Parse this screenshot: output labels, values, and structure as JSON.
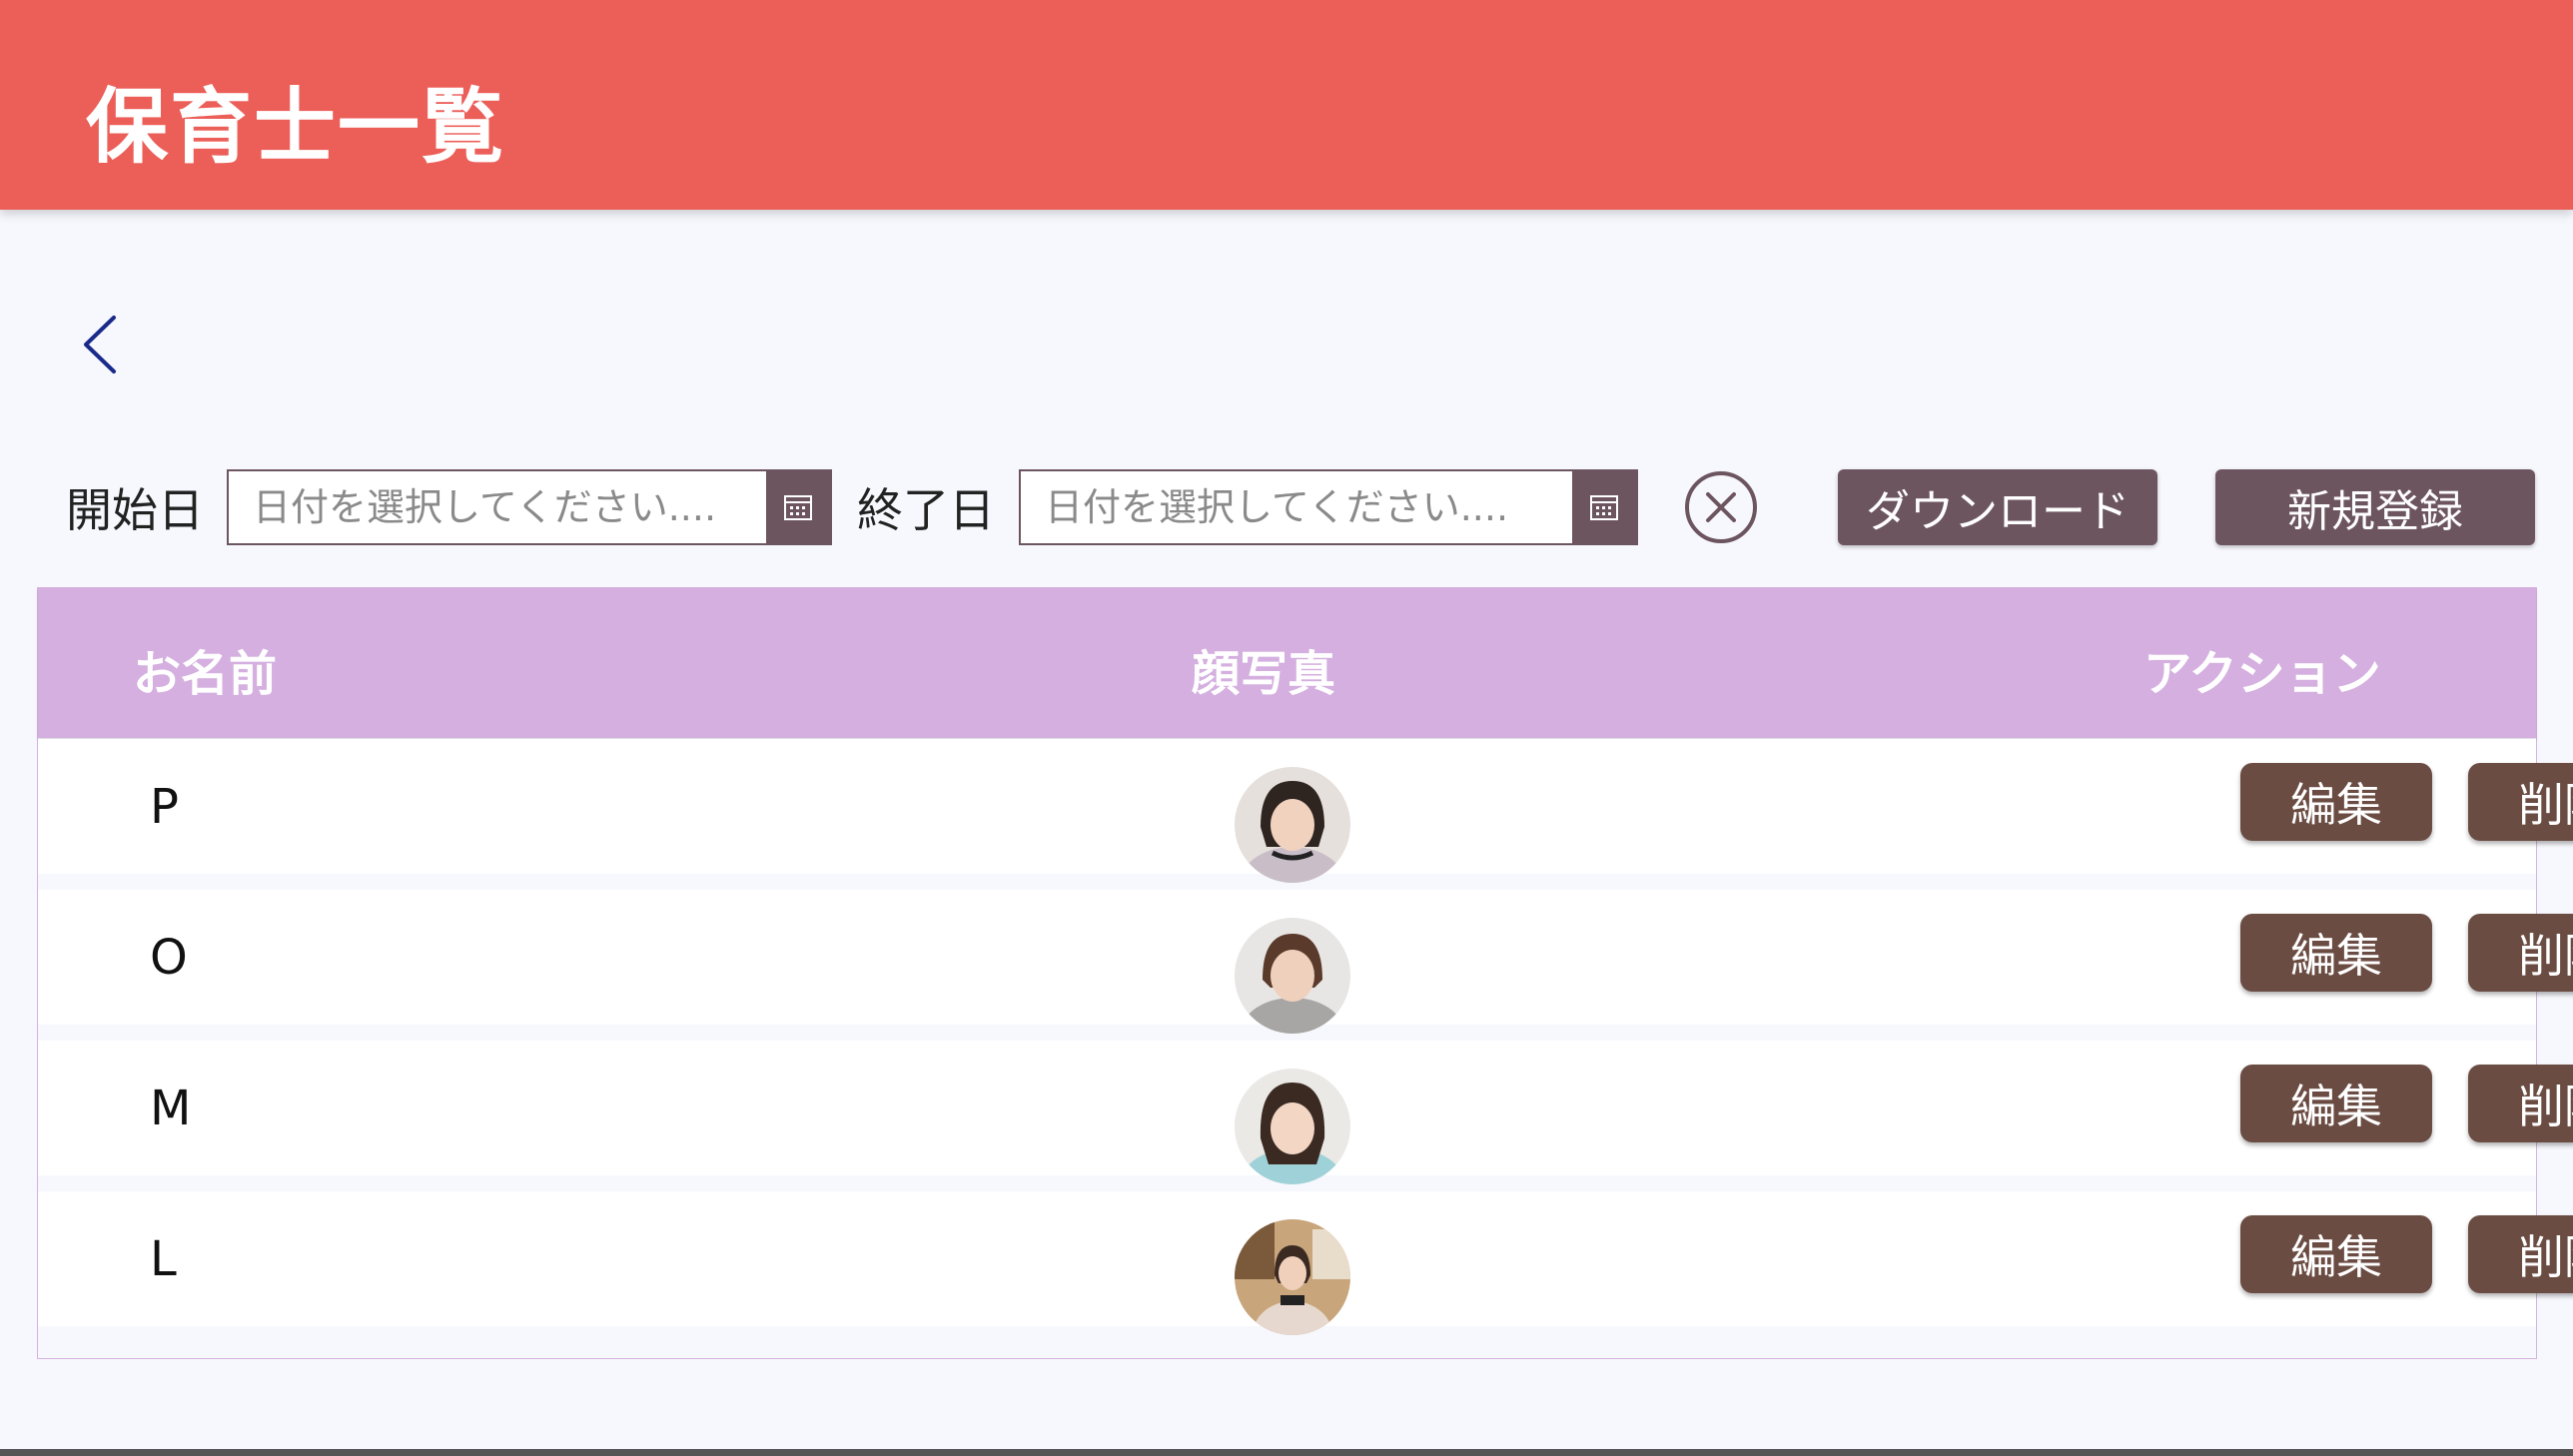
{
  "header": {
    "title": "保育士一覧"
  },
  "filters": {
    "start_label": "開始日",
    "end_label": "終了日",
    "start_placeholder": "日付を選択してください....",
    "end_placeholder": "日付を選択してください....",
    "download_label": "ダウンロード",
    "new_label": "新規登録"
  },
  "table": {
    "columns": [
      "お名前",
      "顔写真",
      "アクション"
    ],
    "rows": [
      {
        "name": "P",
        "edit": "編集",
        "delete": "削除"
      },
      {
        "name": "O",
        "edit": "編集",
        "delete": "削除"
      },
      {
        "name": "M",
        "edit": "編集",
        "delete": "削除"
      },
      {
        "name": "L",
        "edit": "編集",
        "delete": "削除"
      }
    ]
  },
  "colors": {
    "app_bar": "#ec5f59",
    "table_header": "#d4afdf",
    "button": "#6b4c43",
    "background": "#f7f8fd"
  },
  "icons": {
    "back": "chevron-left-icon",
    "calendar": "calendar-icon",
    "clear": "close-circle-icon"
  }
}
